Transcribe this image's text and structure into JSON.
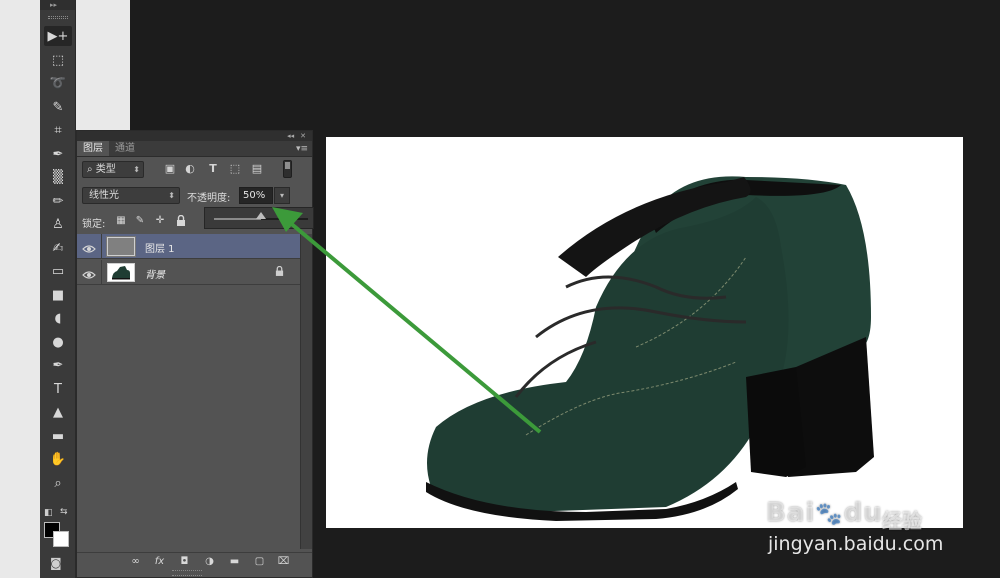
{
  "toolbar": {
    "header_glyph": "▸▸",
    "tools": [
      {
        "icon": "move-icon",
        "glyph": "▶+"
      },
      {
        "icon": "marquee-icon",
        "glyph": "⬚"
      },
      {
        "icon": "lasso-icon",
        "glyph": "➰"
      },
      {
        "icon": "quick-select-icon",
        "glyph": "✎"
      },
      {
        "icon": "crop-icon",
        "glyph": "⌗"
      },
      {
        "icon": "eyedropper-icon",
        "glyph": "✒"
      },
      {
        "icon": "healing-brush-icon",
        "glyph": "▒"
      },
      {
        "icon": "brush-icon",
        "glyph": "✏"
      },
      {
        "icon": "stamp-icon",
        "glyph": "♙"
      },
      {
        "icon": "history-brush-icon",
        "glyph": "✍"
      },
      {
        "icon": "eraser-icon",
        "glyph": "▭"
      },
      {
        "icon": "gradient-icon",
        "glyph": "■"
      },
      {
        "icon": "blur-icon",
        "glyph": "◖"
      },
      {
        "icon": "dodge-icon",
        "glyph": "●"
      },
      {
        "icon": "pen-icon",
        "glyph": "✒"
      },
      {
        "icon": "type-icon",
        "glyph": "T"
      },
      {
        "icon": "path-select-icon",
        "glyph": "▲"
      },
      {
        "icon": "shape-icon",
        "glyph": "▬"
      },
      {
        "icon": "hand-icon",
        "glyph": "✋"
      },
      {
        "icon": "zoom-icon",
        "glyph": "⌕"
      }
    ],
    "foreground_color": "#000000",
    "background_color": "#ffffff"
  },
  "layers_panel": {
    "collapse_glyph": "◂◂",
    "close_glyph": "✕",
    "tabs": [
      "图层",
      "通道"
    ],
    "menu_glyph": "▾≡",
    "filter_label": "⌕ 类型",
    "filter_icons": [
      "▣",
      "◐",
      "T",
      "⬚",
      "▤"
    ],
    "blend_mode": "线性光",
    "opacity_label": "不透明度:",
    "opacity_value": "50%",
    "opacity_percent": 50,
    "lock_label": "锁定:",
    "lock_icons": [
      "▦",
      "✏",
      "✛",
      "ὑ2"
    ],
    "layers": [
      {
        "name": "图层 1",
        "selected": true,
        "thumb": "gray-fill"
      },
      {
        "name": "背景",
        "selected": false,
        "thumb": "shoe-image",
        "locked": true
      }
    ],
    "bottom_icons": [
      "∞",
      "fx",
      "◘",
      "◑",
      "▬",
      "▢",
      "⌧"
    ]
  },
  "watermark": {
    "brand": "Bai",
    "brand2": "du",
    "jingyan": "经验",
    "url": "jingyan.baidu.com"
  },
  "colors": {
    "arrow": "#3c9a3a",
    "selected_layer": "#5b6584",
    "shoe": "#1f3d33"
  }
}
